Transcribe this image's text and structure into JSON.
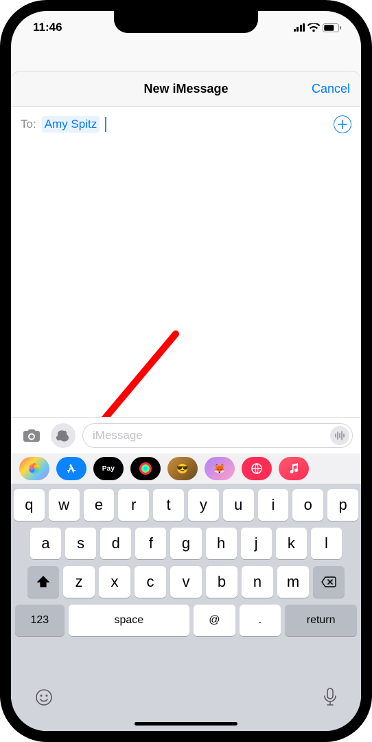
{
  "status": {
    "time": "11:46"
  },
  "nav": {
    "title": "New iMessage",
    "cancel": "Cancel"
  },
  "to": {
    "label": "To:",
    "recipient": "Amy Spitz"
  },
  "compose": {
    "placeholder": "iMessage"
  },
  "apps": {
    "pay_label": "Pay"
  },
  "keyboard": {
    "row1": [
      "q",
      "w",
      "e",
      "r",
      "t",
      "y",
      "u",
      "i",
      "o",
      "p"
    ],
    "row2": [
      "a",
      "s",
      "d",
      "f",
      "g",
      "h",
      "j",
      "k",
      "l"
    ],
    "row3": [
      "z",
      "x",
      "c",
      "v",
      "b",
      "n",
      "m"
    ],
    "k123": "123",
    "space": "space",
    "at": "@",
    "dot": ".",
    "ret": "return"
  }
}
